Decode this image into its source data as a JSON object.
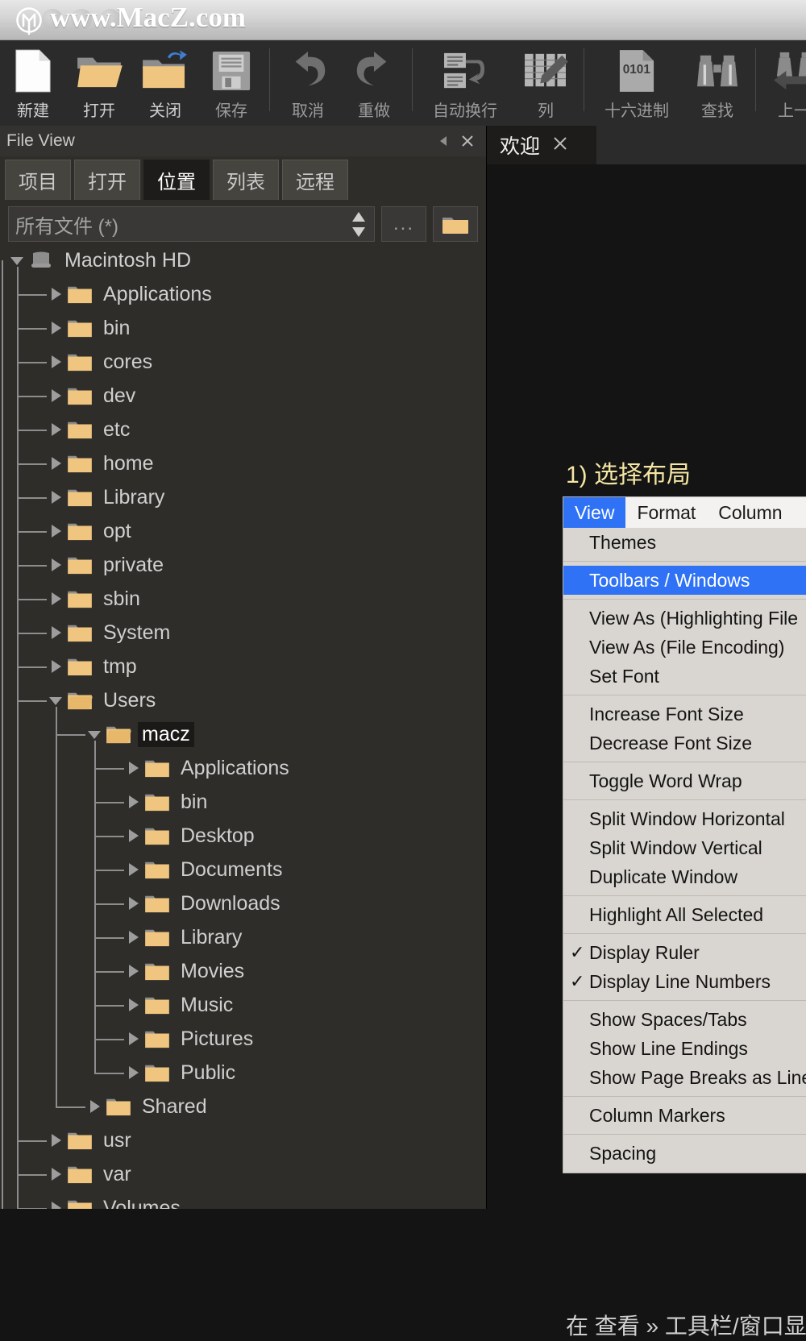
{
  "titlebar": {
    "site": "www.MacZ.com",
    "logo_icon": "macz-circle-m-logo"
  },
  "toolbar": {
    "items": [
      {
        "label": "新建",
        "icon": "new-document-icon",
        "enabled": true
      },
      {
        "label": "打开",
        "icon": "open-folder-icon",
        "enabled": true
      },
      {
        "label": "关闭",
        "icon": "close-folder-icon",
        "enabled": true
      },
      {
        "label": "保存",
        "icon": "save-floppy-icon",
        "enabled": false
      },
      {
        "label": "取消",
        "icon": "undo-arrow-icon",
        "enabled": false
      },
      {
        "label": "重做",
        "icon": "redo-arrow-icon",
        "enabled": false
      },
      {
        "label": "自动换行",
        "icon": "word-wrap-icon",
        "enabled": false
      },
      {
        "label": "列",
        "icon": "column-edit-icon",
        "enabled": false
      },
      {
        "label": "十六进制",
        "icon": "hex-0101-icon",
        "enabled": false
      },
      {
        "label": "查找",
        "icon": "binoculars-find-icon",
        "enabled": false
      },
      {
        "label": "上一",
        "icon": "find-previous-icon",
        "enabled": false
      }
    ]
  },
  "file_view": {
    "title": "File View",
    "collapse_icon": "collapse-left-triangle-icon",
    "close_icon": "close-x-icon",
    "tabs": [
      {
        "label": "项目",
        "selected": false
      },
      {
        "label": "打开",
        "selected": false
      },
      {
        "label": "位置",
        "selected": true
      },
      {
        "label": "列表",
        "selected": false
      },
      {
        "label": "远程",
        "selected": false
      }
    ],
    "filter": {
      "value": "所有文件 (*)",
      "spinner_icon": "up-down-spinner-icon",
      "more_button": "...",
      "folder_button_icon": "folder-icon"
    },
    "tree": [
      {
        "label": "Macintosh HD",
        "depth": 0,
        "icon": "harddisk-icon",
        "state": "expanded",
        "selected": false
      },
      {
        "label": "Applications",
        "depth": 1,
        "icon": "folder-icon",
        "state": "collapsed",
        "selected": false
      },
      {
        "label": "bin",
        "depth": 1,
        "icon": "folder-icon",
        "state": "collapsed",
        "selected": false
      },
      {
        "label": "cores",
        "depth": 1,
        "icon": "folder-icon",
        "state": "collapsed",
        "selected": false
      },
      {
        "label": "dev",
        "depth": 1,
        "icon": "folder-icon",
        "state": "collapsed",
        "selected": false
      },
      {
        "label": "etc",
        "depth": 1,
        "icon": "folder-icon",
        "state": "collapsed",
        "selected": false
      },
      {
        "label": "home",
        "depth": 1,
        "icon": "folder-icon",
        "state": "collapsed",
        "selected": false
      },
      {
        "label": "Library",
        "depth": 1,
        "icon": "folder-icon",
        "state": "collapsed",
        "selected": false
      },
      {
        "label": "opt",
        "depth": 1,
        "icon": "folder-icon",
        "state": "collapsed",
        "selected": false
      },
      {
        "label": "private",
        "depth": 1,
        "icon": "folder-icon",
        "state": "collapsed",
        "selected": false
      },
      {
        "label": "sbin",
        "depth": 1,
        "icon": "folder-icon",
        "state": "collapsed",
        "selected": false
      },
      {
        "label": "System",
        "depth": 1,
        "icon": "folder-icon",
        "state": "collapsed",
        "selected": false
      },
      {
        "label": "tmp",
        "depth": 1,
        "icon": "folder-icon",
        "state": "collapsed",
        "selected": false
      },
      {
        "label": "Users",
        "depth": 1,
        "icon": "folder-icon",
        "state": "expanded",
        "selected": false
      },
      {
        "label": "macz",
        "depth": 2,
        "icon": "folder-icon",
        "state": "expanded",
        "selected": true
      },
      {
        "label": "Applications",
        "depth": 3,
        "icon": "folder-icon",
        "state": "collapsed",
        "selected": false
      },
      {
        "label": "bin",
        "depth": 3,
        "icon": "folder-icon",
        "state": "collapsed",
        "selected": false
      },
      {
        "label": "Desktop",
        "depth": 3,
        "icon": "folder-icon",
        "state": "collapsed",
        "selected": false
      },
      {
        "label": "Documents",
        "depth": 3,
        "icon": "folder-icon",
        "state": "collapsed",
        "selected": false
      },
      {
        "label": "Downloads",
        "depth": 3,
        "icon": "folder-icon",
        "state": "collapsed",
        "selected": false
      },
      {
        "label": "Library",
        "depth": 3,
        "icon": "folder-icon",
        "state": "collapsed",
        "selected": false
      },
      {
        "label": "Movies",
        "depth": 3,
        "icon": "folder-icon",
        "state": "collapsed",
        "selected": false
      },
      {
        "label": "Music",
        "depth": 3,
        "icon": "folder-icon",
        "state": "collapsed",
        "selected": false
      },
      {
        "label": "Pictures",
        "depth": 3,
        "icon": "folder-icon",
        "state": "collapsed",
        "selected": false
      },
      {
        "label": "Public",
        "depth": 3,
        "icon": "folder-icon",
        "state": "collapsed",
        "selected": false
      },
      {
        "label": "Shared",
        "depth": 2,
        "icon": "folder-icon",
        "state": "collapsed",
        "selected": false
      },
      {
        "label": "usr",
        "depth": 1,
        "icon": "folder-icon",
        "state": "collapsed",
        "selected": false
      },
      {
        "label": "var",
        "depth": 1,
        "icon": "folder-icon",
        "state": "collapsed",
        "selected": false
      },
      {
        "label": "Volumes",
        "depth": 1,
        "icon": "folder-icon",
        "state": "collapsed",
        "selected": false
      }
    ]
  },
  "editor": {
    "tabs": [
      {
        "label": "欢迎",
        "close_icon": "close-x-icon",
        "active": true
      }
    ]
  },
  "welcome": {
    "step_title": "1) 选择布局",
    "footer_note": "在 查看 » 工具栏/窗口显",
    "menu": {
      "menubar": [
        {
          "label": "View",
          "selected": true
        },
        {
          "label": "Format",
          "selected": false
        },
        {
          "label": "Column",
          "selected": false
        }
      ],
      "groups": [
        {
          "items": [
            {
              "label": "Themes",
              "checked": false,
              "highlighted": false
            }
          ]
        },
        {
          "items": [
            {
              "label": "Toolbars / Windows",
              "checked": false,
              "highlighted": true
            }
          ]
        },
        {
          "items": [
            {
              "label": "View As (Highlighting File",
              "checked": false,
              "highlighted": false
            },
            {
              "label": "View As (File Encoding)",
              "checked": false,
              "highlighted": false
            },
            {
              "label": "Set Font",
              "checked": false,
              "highlighted": false
            }
          ]
        },
        {
          "items": [
            {
              "label": "Increase Font Size",
              "checked": false,
              "highlighted": false
            },
            {
              "label": "Decrease Font Size",
              "checked": false,
              "highlighted": false
            }
          ]
        },
        {
          "items": [
            {
              "label": "Toggle Word Wrap",
              "checked": false,
              "highlighted": false
            }
          ]
        },
        {
          "items": [
            {
              "label": "Split Window Horizontal",
              "checked": false,
              "highlighted": false
            },
            {
              "label": "Split Window Vertical",
              "checked": false,
              "highlighted": false
            },
            {
              "label": "Duplicate Window",
              "checked": false,
              "highlighted": false
            }
          ]
        },
        {
          "items": [
            {
              "label": "Highlight All Selected",
              "checked": false,
              "highlighted": false
            }
          ]
        },
        {
          "items": [
            {
              "label": "Display Ruler",
              "checked": true,
              "highlighted": false
            },
            {
              "label": "Display Line Numbers",
              "checked": true,
              "highlighted": false
            }
          ]
        },
        {
          "items": [
            {
              "label": "Show Spaces/Tabs",
              "checked": false,
              "highlighted": false
            },
            {
              "label": "Show Line Endings",
              "checked": false,
              "highlighted": false
            },
            {
              "label": "Show Page Breaks as Line",
              "checked": false,
              "highlighted": false
            }
          ]
        },
        {
          "items": [
            {
              "label": "Column Markers",
              "checked": false,
              "highlighted": false
            }
          ]
        },
        {
          "items": [
            {
              "label": "Spacing",
              "checked": false,
              "highlighted": false
            }
          ]
        }
      ]
    }
  },
  "colors": {
    "toolbar_bg": "#2b2b2b",
    "panel_bg": "#2e2d2a",
    "editor_bg": "#141414",
    "accent_blue": "#2f72f5",
    "folder_yellow": "#efc57f",
    "step_gold": "#f6e6a4"
  }
}
